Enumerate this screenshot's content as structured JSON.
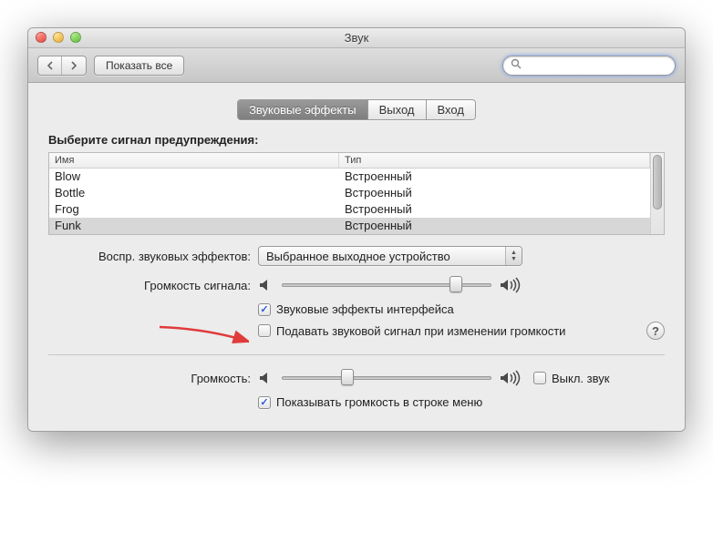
{
  "window": {
    "title": "Звук"
  },
  "toolbar": {
    "show_all": "Показать все",
    "search_placeholder": ""
  },
  "tabs": {
    "effects": "Звуковые эффекты",
    "output": "Выход",
    "input": "Вход"
  },
  "alerts": {
    "heading": "Выберите сигнал предупреждения:",
    "col_name": "Имя",
    "col_type": "Тип",
    "rows": [
      {
        "name": "Blow",
        "type": "Встроенный"
      },
      {
        "name": "Bottle",
        "type": "Встроенный"
      },
      {
        "name": "Frog",
        "type": "Встроенный"
      },
      {
        "name": "Funk",
        "type": "Встроенный"
      }
    ]
  },
  "playthrough": {
    "label": "Воспр. звуковых эффектов:",
    "value": "Выбранное выходное устройство"
  },
  "alert_volume": {
    "label": "Громкость сигнала:",
    "value": 0.85
  },
  "checks": {
    "ui_sounds": {
      "label": "Звуковые эффекты интерфейса",
      "checked": true
    },
    "feedback": {
      "label": "Подавать звуковой сигнал при изменении громкости",
      "checked": false
    }
  },
  "output_volume": {
    "label": "Громкость:",
    "value": 0.3,
    "mute_label": "Выкл. звук",
    "mute_checked": false
  },
  "menu_bar": {
    "label": "Показывать громкость в строке меню",
    "checked": true
  }
}
